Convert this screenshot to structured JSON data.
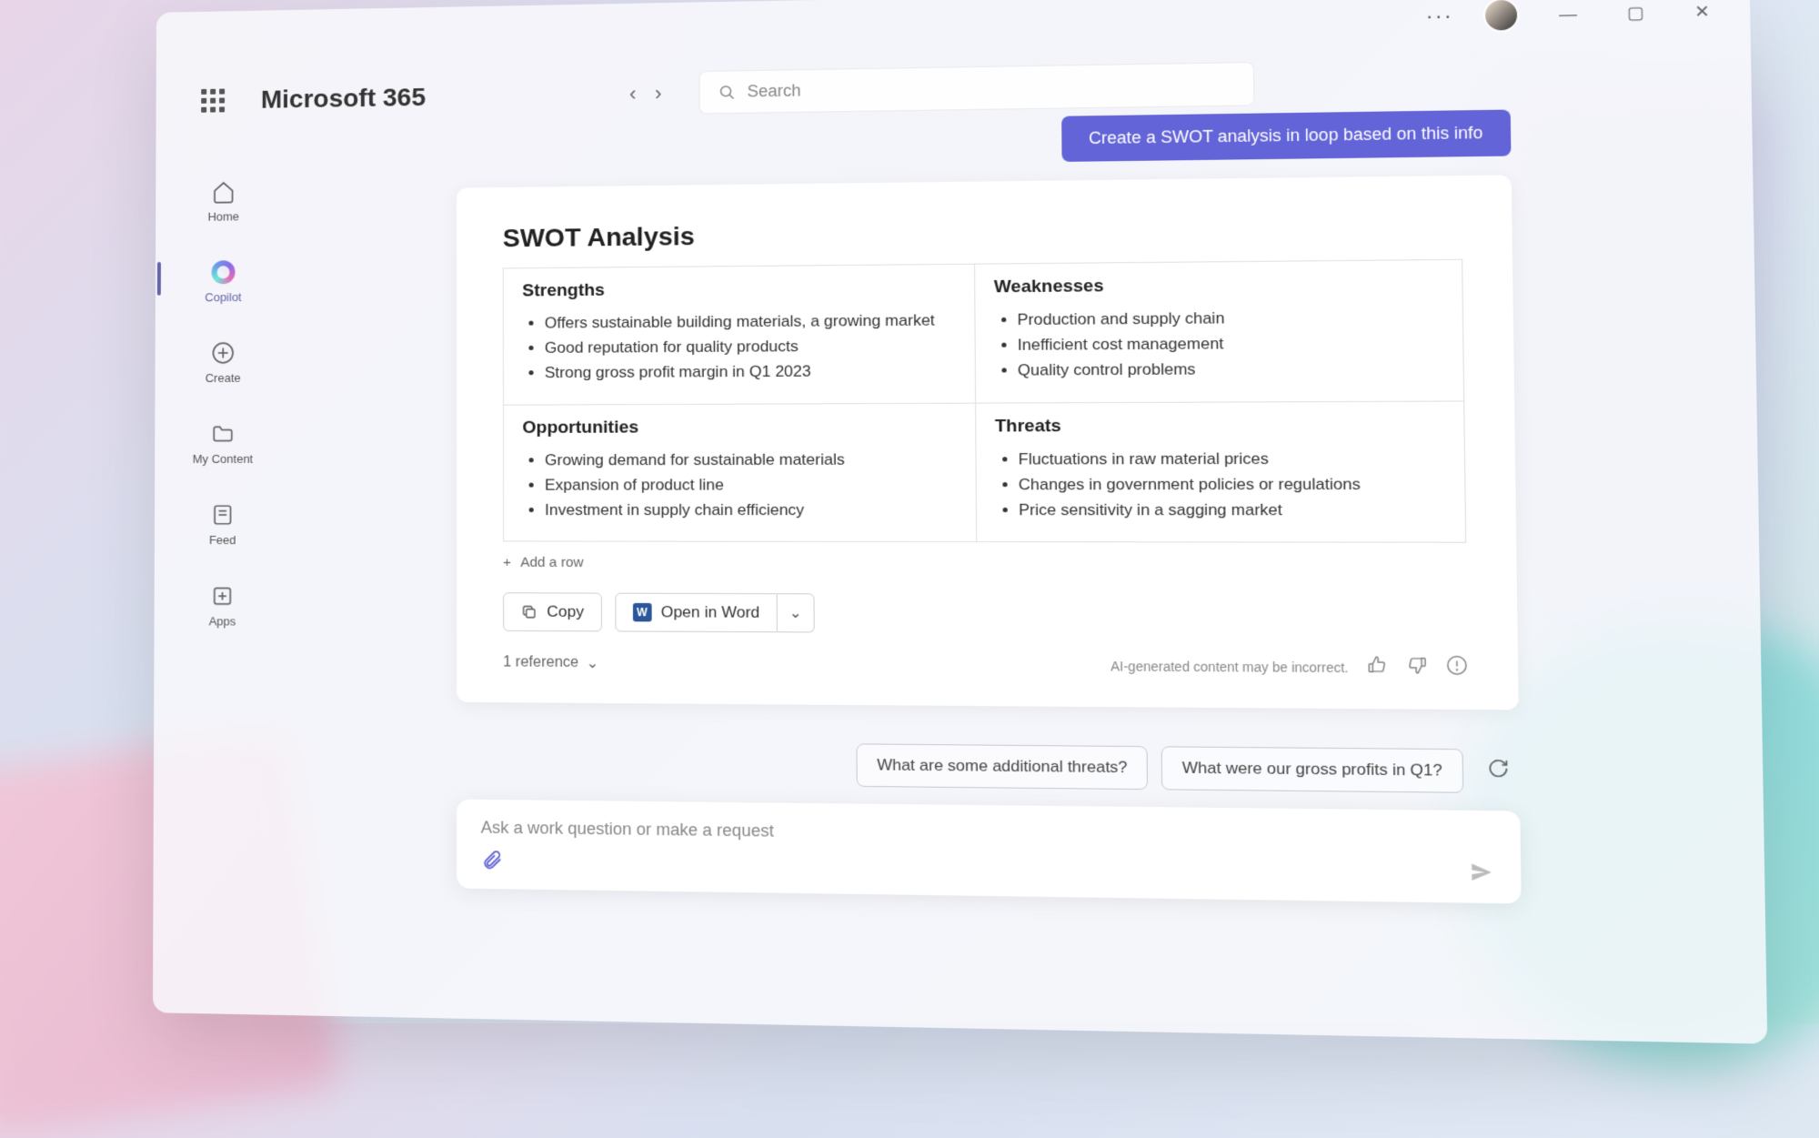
{
  "app_title": "Microsoft 365",
  "search": {
    "placeholder": "Search"
  },
  "window_controls": {
    "more": "···",
    "min": "—",
    "max": "▢",
    "close": "✕"
  },
  "sidebar": {
    "items": [
      {
        "label": "Home"
      },
      {
        "label": "Copilot"
      },
      {
        "label": "Create"
      },
      {
        "label": "My Content"
      },
      {
        "label": "Feed"
      },
      {
        "label": "Apps"
      }
    ]
  },
  "chat": {
    "user_message": "Create a SWOT analysis in loop based on this info",
    "response": {
      "title": "SWOT Analysis",
      "quadrants": {
        "strengths": {
          "heading": "Strengths",
          "items": [
            "Offers sustainable building materials, a growing market",
            "Good reputation for quality products",
            "Strong gross profit margin in Q1 2023"
          ]
        },
        "weaknesses": {
          "heading": "Weaknesses",
          "items": [
            "Production and supply chain",
            "Inefficient cost management",
            "Quality control problems"
          ]
        },
        "opportunities": {
          "heading": "Opportunities",
          "items": [
            "Growing demand for sustainable materials",
            "Expansion of product line",
            "Investment in supply chain efficiency"
          ]
        },
        "threats": {
          "heading": "Threats",
          "items": [
            "Fluctuations in raw material prices",
            "Changes in government policies or regulations",
            "Price sensitivity in a sagging market"
          ]
        }
      },
      "add_row_label": "Add a row",
      "actions": {
        "copy": "Copy",
        "open_word": "Open in Word"
      },
      "references_label": "1 reference",
      "disclaimer": "AI-generated content may be incorrect."
    },
    "suggestions": [
      "What are some additional threats?",
      "What were our gross profits in Q1?"
    ],
    "prompt_placeholder": "Ask a work question or make a request"
  }
}
